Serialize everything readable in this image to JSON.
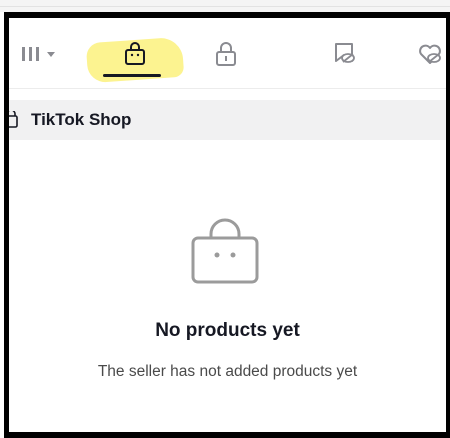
{
  "tabs": [
    {
      "icon": "grid-icon"
    },
    {
      "icon": "shopping-bag-icon",
      "active": true
    },
    {
      "icon": "lock-icon"
    },
    {
      "icon": "hidden-icon"
    },
    {
      "icon": "liked-icon"
    }
  ],
  "section": {
    "icon": "shopping-bag-icon",
    "title": "TikTok Shop"
  },
  "empty_state": {
    "icon": "shopping-bag-icon",
    "title": "No products yet",
    "subtitle": "The seller has not added products yet"
  },
  "colors": {
    "highlight": "#fbef6b",
    "text": "#161823",
    "header_bg": "#f1f1f2",
    "frame": "#000000"
  }
}
